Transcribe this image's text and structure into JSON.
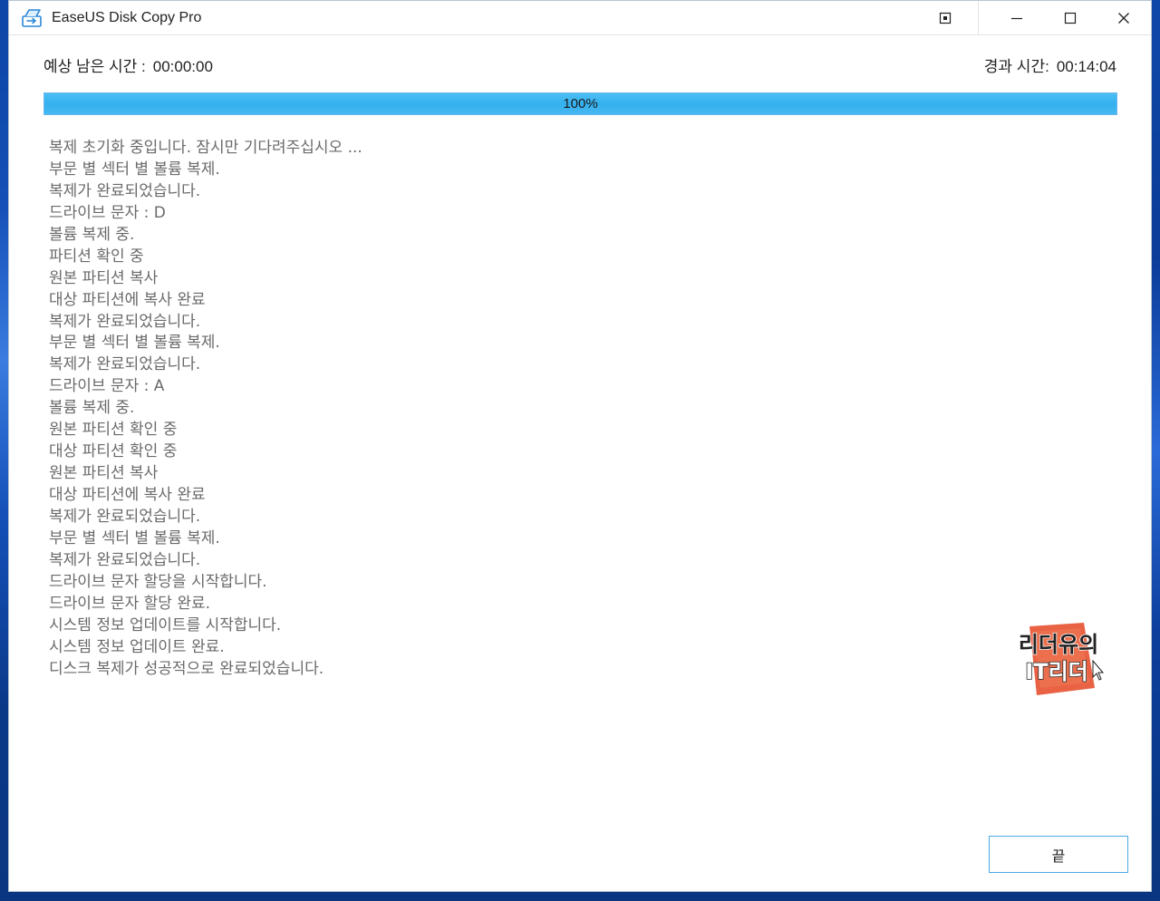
{
  "window": {
    "title": "EaseUS Disk Copy Pro",
    "controls": {
      "pin_icon": "pin-icon",
      "minimize_icon": "minimize-icon",
      "maximize_icon": "maximize-icon",
      "close_icon": "close-icon"
    }
  },
  "status": {
    "remaining_label": "예상 남은 시간 :",
    "remaining_value": "00:00:00",
    "elapsed_label": "경과 시간:",
    "elapsed_value": "00:14:04"
  },
  "progress": {
    "percent": 100,
    "label": "100%"
  },
  "log": [
    "복제 초기화 중입니다. 잠시만 기다려주십시오 ...",
    "부문 별 섹터 별 볼륨 복제.",
    "복제가 완료되었습니다.",
    "드라이브 문자 : D",
    "볼륨 복제 중.",
    "파티션 확인 중",
    "원본 파티션 복사",
    "대상 파티션에 복사 완료",
    "복제가 완료되었습니다.",
    "부문 별 섹터 별 볼륨 복제.",
    "복제가 완료되었습니다.",
    "드라이브 문자 : A",
    "볼륨 복제 중.",
    "원본 파티션 확인 중",
    "대상 파티션 확인 중",
    "원본 파티션 복사",
    "대상 파티션에 복사 완료",
    "복제가 완료되었습니다.",
    "부문 별 섹터 별 볼륨 복제.",
    "복제가 완료되었습니다.",
    "드라이브 문자 할당을 시작합니다.",
    "드라이브 문자 할당 완료.",
    "시스템 정보 업데이트를 시작합니다.",
    "시스템 정보 업데이트 완료.",
    "디스크 복제가 성공적으로 완료되었습니다."
  ],
  "watermark": {
    "line1": "리더유의",
    "line2": "IT리더"
  },
  "finish_button": "끝",
  "colors": {
    "progress_fill": "#35b0ef",
    "progress_border": "#6db7ee",
    "log_text": "#6a6a6a",
    "button_border": "#4aa8e8",
    "watermark_fill": "#e85a3a"
  }
}
